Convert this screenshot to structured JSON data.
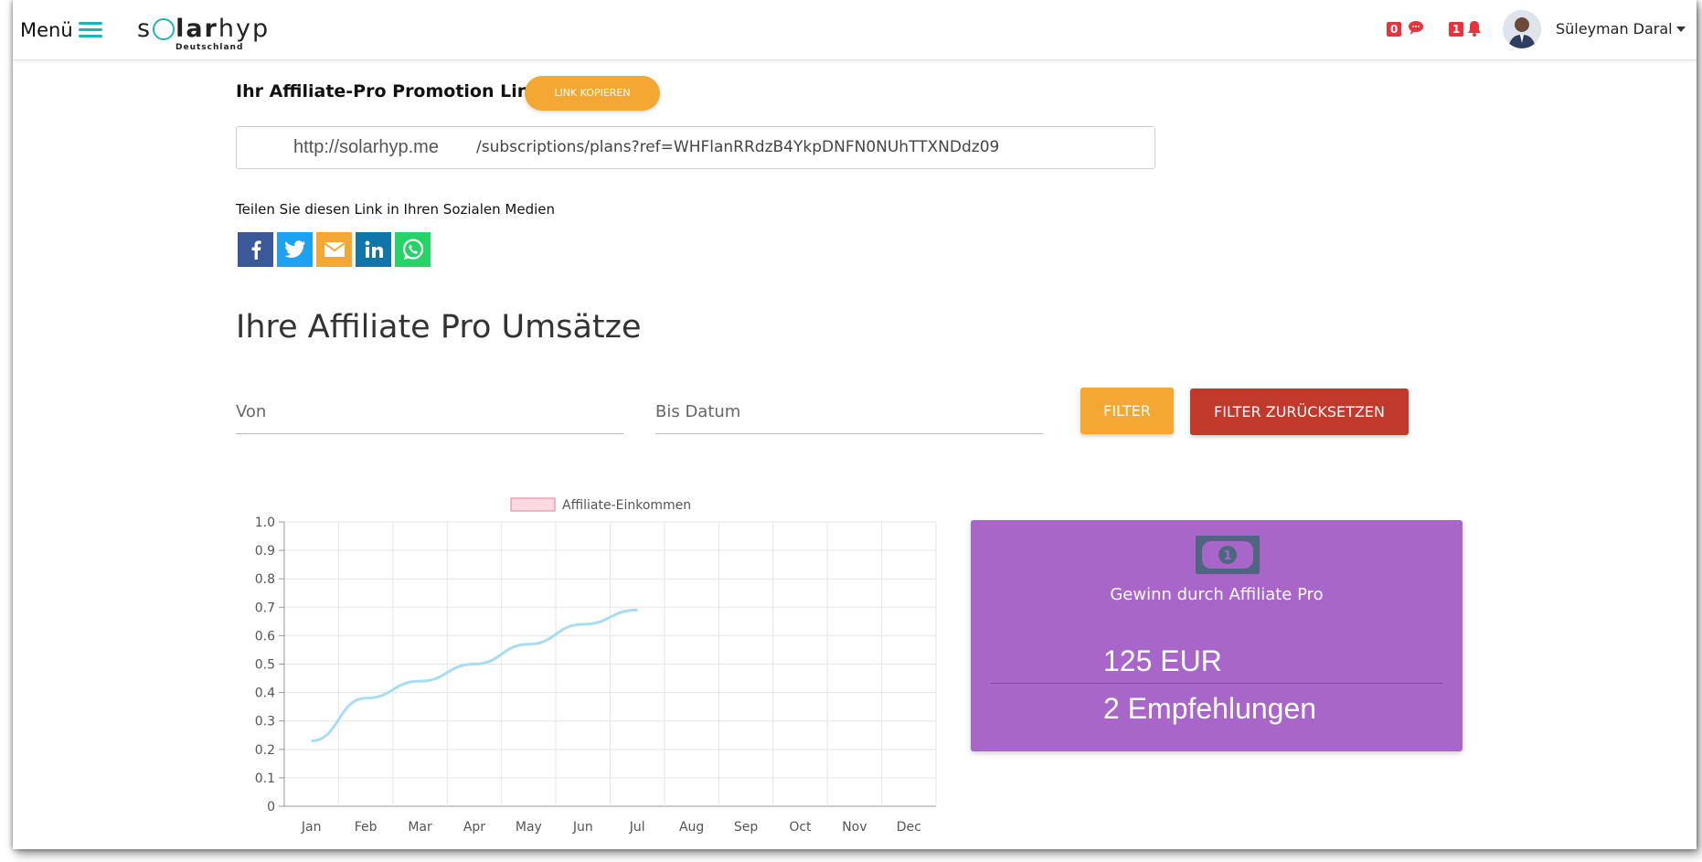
{
  "header": {
    "menu_label": "Menü",
    "logo_text": "solarhyp",
    "logo_subtext": "Deutschland",
    "messages_count": "0",
    "notifications_count": "1",
    "user_name": "Süleyman Daral"
  },
  "promo": {
    "title": "Ihr Affiliate-Pro Promotion Link",
    "copy_button": "LINK KOPIEREN",
    "link_domain": "http://solarhyp.me",
    "link_path": "/subscriptions/plans?ref=WHFlanRRdzB4YkpDNFN0NUhTTXNDdz09",
    "share_text": "Teilen Sie diesen Link in Ihren Sozialen Medien",
    "share_icons": [
      "facebook-icon",
      "twitter-icon",
      "email-icon",
      "linkedin-icon",
      "whatsapp-icon"
    ]
  },
  "sales": {
    "title": "Ihre Affiliate Pro Umsätze",
    "from_placeholder": "Von",
    "to_placeholder": "Bis Datum",
    "filter_button": "FILTER",
    "reset_button": "FILTER ZURÜCKSETZEN"
  },
  "stats": {
    "title": "Gewinn durch Affiliate Pro",
    "amount": "125 EUR",
    "referrals": "2 Empfehlungen"
  },
  "colors": {
    "accent": "#1cb5b5",
    "orange": "#f5a733",
    "red": "#c0392b",
    "card": "#a966c9",
    "line": "#a8dcf0"
  },
  "chart_data": {
    "type": "line",
    "categories": [
      "Jan",
      "Feb",
      "Mar",
      "Apr",
      "May",
      "Jun",
      "Jul",
      "Aug",
      "Sep",
      "Oct",
      "Nov",
      "Dec"
    ],
    "series": [
      {
        "name": "Affiliate-Einkommen",
        "values": [
          0.23,
          0.38,
          0.44,
          0.5,
          0.57,
          0.64,
          0.69,
          null,
          null,
          null,
          null,
          null
        ]
      }
    ],
    "yticks": [
      "0",
      "0.1",
      "0.2",
      "0.3",
      "0.4",
      "0.5",
      "0.6",
      "0.7",
      "0.8",
      "0.9",
      "1.0"
    ],
    "ylim": [
      0,
      1.0
    ],
    "grid": true,
    "legend": "top"
  }
}
